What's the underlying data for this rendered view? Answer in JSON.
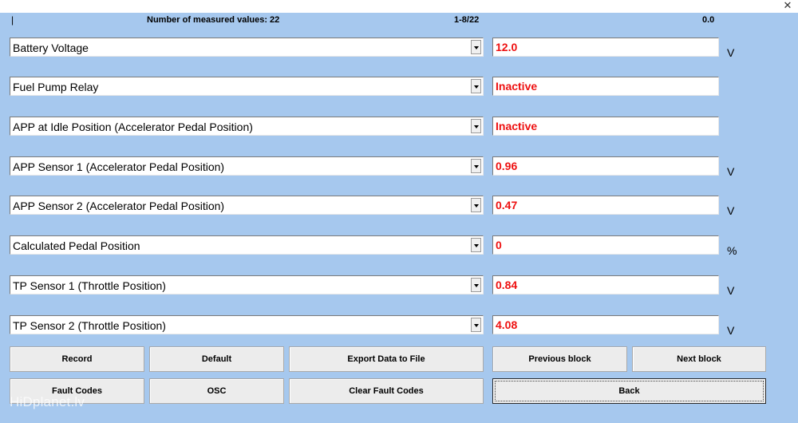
{
  "window": {
    "close_glyph": "✕"
  },
  "header": {
    "marker": "|",
    "count_text": "Number of measured values: 22",
    "page_text": "1-8/22",
    "time_text": "0.0"
  },
  "rows": [
    {
      "label": "Battery Voltage",
      "value": "12.0",
      "unit": "V"
    },
    {
      "label": "Fuel Pump Relay",
      "value": "Inactive",
      "unit": ""
    },
    {
      "label": "APP at Idle Position (Accelerator Pedal Position)",
      "value": "Inactive",
      "unit": ""
    },
    {
      "label": "APP Sensor 1 (Accelerator Pedal Position)",
      "value": "0.96",
      "unit": "V"
    },
    {
      "label": "APP Sensor 2 (Accelerator Pedal Position)",
      "value": "0.47",
      "unit": "V"
    },
    {
      "label": "Calculated Pedal Position",
      "value": "0",
      "unit": "%"
    },
    {
      "label": "TP Sensor 1 (Throttle Position)",
      "value": "0.84",
      "unit": "V"
    },
    {
      "label": "TP Sensor 2 (Throttle Position)",
      "value": "4.08",
      "unit": "V"
    }
  ],
  "buttons": {
    "record": "Record",
    "default": "Default",
    "export": "Export Data to File",
    "previous": "Previous block",
    "next": "Next block",
    "fault_codes": "Fault Codes",
    "osc": "OSC",
    "clear_fault_codes": "Clear Fault Codes",
    "back": "Back"
  },
  "watermark": "HiDplanet.lv",
  "colors": {
    "background": "#a6c8ee",
    "value_text": "#ee1111"
  }
}
